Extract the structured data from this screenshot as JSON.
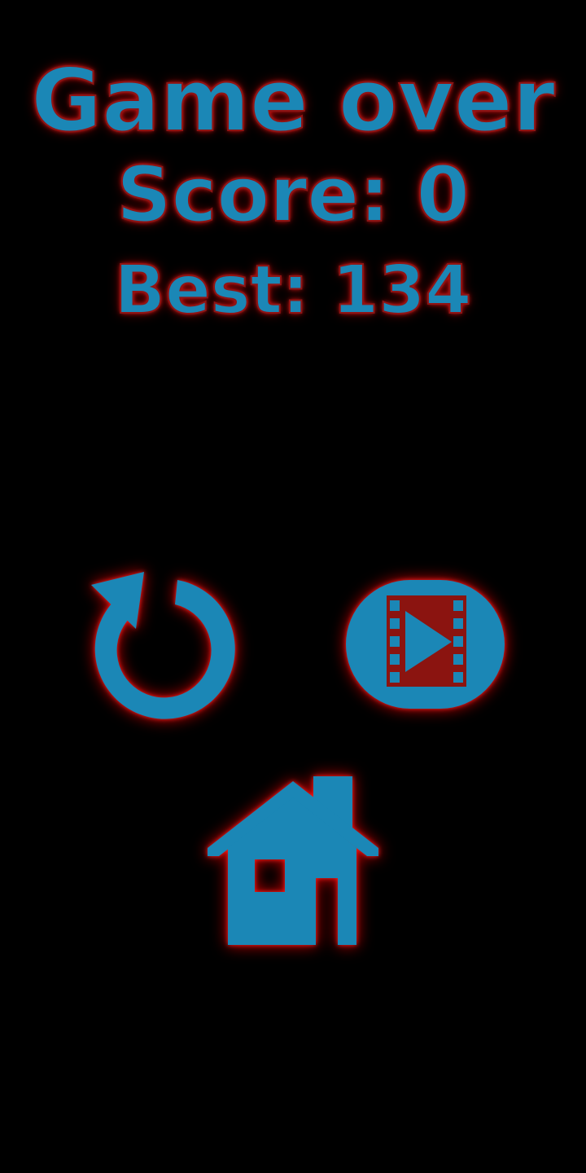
{
  "game_over": {
    "title": "Game over",
    "score_text": "Score: 0",
    "best_text": "Best: 134"
  },
  "buttons": [
    {
      "name": "restart",
      "icon": "restart-icon"
    },
    {
      "name": "watch-video",
      "icon": "video-play-icon"
    },
    {
      "name": "home",
      "icon": "home-icon"
    }
  ],
  "colors": {
    "background": "#000000",
    "primary": "#1b87b6",
    "glow": "#ff2020",
    "accent": "#8b1410"
  }
}
